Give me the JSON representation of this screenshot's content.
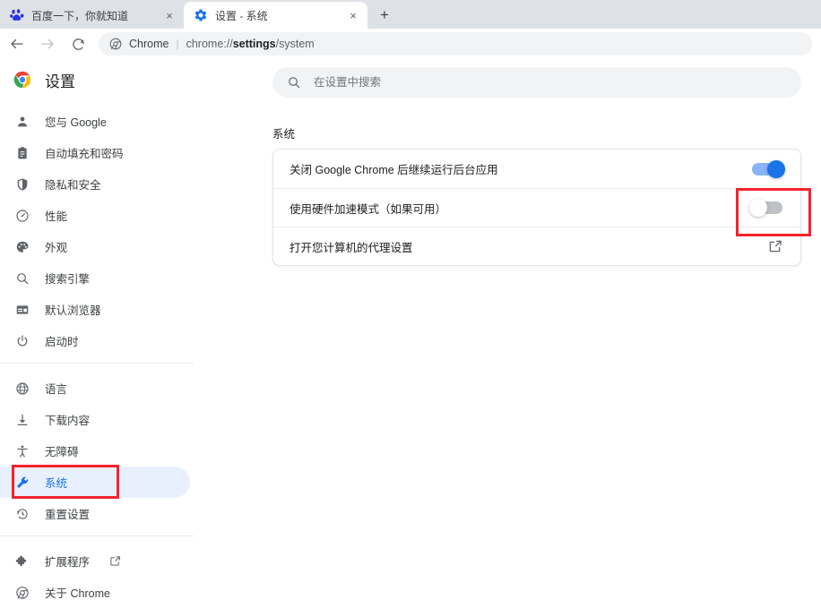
{
  "browser": {
    "tabs": [
      {
        "title": "百度一下，你就知道",
        "favicon": "baidu-icon",
        "active": false,
        "close_label": "×"
      },
      {
        "title": "设置 - 系统",
        "favicon": "gear-icon",
        "active": true,
        "close_label": "×"
      }
    ],
    "new_tab_label": "+",
    "nav": {
      "back": "←",
      "forward": "→",
      "reload": "⟳"
    },
    "omnibox": {
      "chrome_label": "Chrome",
      "separator": "|",
      "url_prefix": "chrome://",
      "url_bold": "settings",
      "url_suffix": "/system"
    }
  },
  "sidebar": {
    "brand_title": "设置",
    "groups": [
      {
        "items": [
          {
            "label": "您与 Google",
            "icon": "person-icon",
            "selected": false
          },
          {
            "label": "自动填充和密码",
            "icon": "clipboard-icon",
            "selected": false
          },
          {
            "label": "隐私和安全",
            "icon": "shield-icon",
            "selected": false
          },
          {
            "label": "性能",
            "icon": "speedometer-icon",
            "selected": false
          },
          {
            "label": "外观",
            "icon": "palette-icon",
            "selected": false
          },
          {
            "label": "搜索引擎",
            "icon": "search-icon",
            "selected": false
          },
          {
            "label": "默认浏览器",
            "icon": "browser-window-icon",
            "selected": false
          },
          {
            "label": "启动时",
            "icon": "power-icon",
            "selected": false
          }
        ]
      },
      {
        "items": [
          {
            "label": "语言",
            "icon": "globe-icon",
            "selected": false
          },
          {
            "label": "下载内容",
            "icon": "download-icon",
            "selected": false
          },
          {
            "label": "无障碍",
            "icon": "accessibility-icon",
            "selected": false
          },
          {
            "label": "系统",
            "icon": "wrench-icon",
            "selected": true
          },
          {
            "label": "重置设置",
            "icon": "history-restore-icon",
            "selected": false
          }
        ]
      },
      {
        "items": [
          {
            "label": "扩展程序",
            "icon": "puzzle-icon",
            "selected": false,
            "external": true
          },
          {
            "label": "关于 Chrome",
            "icon": "chrome-icon",
            "selected": false
          }
        ]
      }
    ]
  },
  "main": {
    "search": {
      "placeholder": "在设置中搜索",
      "value": "",
      "icon": "search-icon"
    },
    "section_title": "系统",
    "rows": [
      {
        "label": "关闭 Google Chrome 后继续运行后台应用",
        "control": "toggle",
        "state": "on"
      },
      {
        "label": "使用硬件加速模式（如果可用）",
        "control": "toggle",
        "state": "off"
      },
      {
        "label": "打开您计算机的代理设置",
        "control": "external-link"
      }
    ]
  },
  "annotations": {
    "highlight_color": "#f5222d",
    "boxes": [
      {
        "name": "hardware-acceleration-toggle-highlight"
      },
      {
        "name": "sidebar-system-highlight"
      }
    ]
  },
  "colors": {
    "accent_blue": "#1a73e8",
    "toggle_on_track": "#8ab4f8",
    "toggle_off_track": "#bdc1c6",
    "selected_pill": "#e8f0fe",
    "tabstrip_bg": "#dee1e6",
    "omnibox_bg": "#f1f3f4"
  }
}
